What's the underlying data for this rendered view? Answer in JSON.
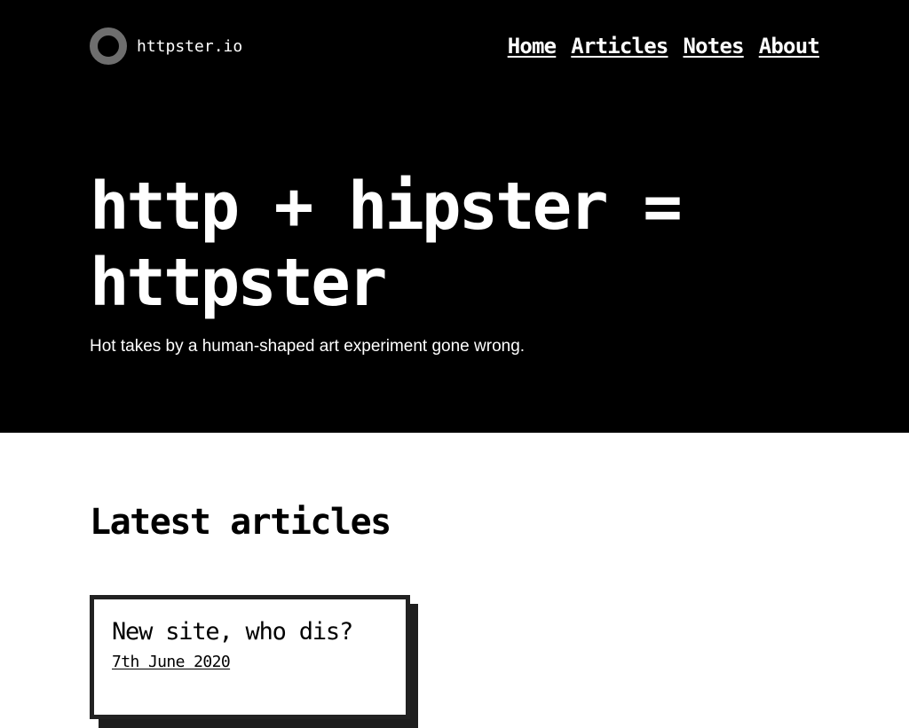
{
  "site": {
    "name": "httpster.io"
  },
  "nav": {
    "items": [
      {
        "label": "Home"
      },
      {
        "label": "Articles"
      },
      {
        "label": "Notes"
      },
      {
        "label": "About"
      }
    ]
  },
  "hero": {
    "title_line1": "http + hipster =",
    "title_line2": "httpster",
    "tagline": "Hot takes by a human-shaped art experiment gone wrong."
  },
  "latest": {
    "heading": "Latest articles",
    "articles": [
      {
        "title": "New site, who dis?",
        "date": "7th June 2020"
      }
    ]
  },
  "colors": {
    "hero_background": "#000000",
    "hero_text": "#ffffff",
    "logo_ring": "#6e6e6e",
    "page_background": "#ffffff",
    "card_border": "#222222",
    "card_shadow": "#1e1e1e"
  },
  "icons": {
    "logo": "ring-logo-icon"
  }
}
